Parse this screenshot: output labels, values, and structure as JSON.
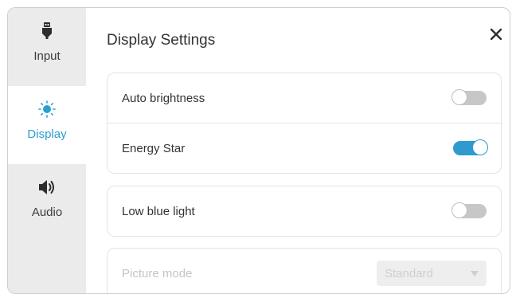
{
  "nav": [
    {
      "id": "input",
      "label": "Input",
      "icon": "input-plug-icon",
      "active": false
    },
    {
      "id": "display",
      "label": "Display",
      "icon": "sun-icon",
      "active": true
    },
    {
      "id": "audio",
      "label": "Audio",
      "icon": "speaker-icon",
      "active": false
    }
  ],
  "title": "Display Settings",
  "close_icon": "close-icon",
  "colors": {
    "accent": "#2f9ad0",
    "sidebar_bg": "#ebebeb",
    "toggle_off": "#c7c7c7"
  },
  "settings": {
    "auto_brightness": {
      "label": "Auto brightness",
      "enabled": false
    },
    "energy_star": {
      "label": "Energy Star",
      "enabled": true
    },
    "low_blue_light": {
      "label": "Low blue light",
      "enabled": false
    },
    "picture_mode": {
      "label": "Picture mode",
      "value": "Standard",
      "disabled": true
    }
  }
}
